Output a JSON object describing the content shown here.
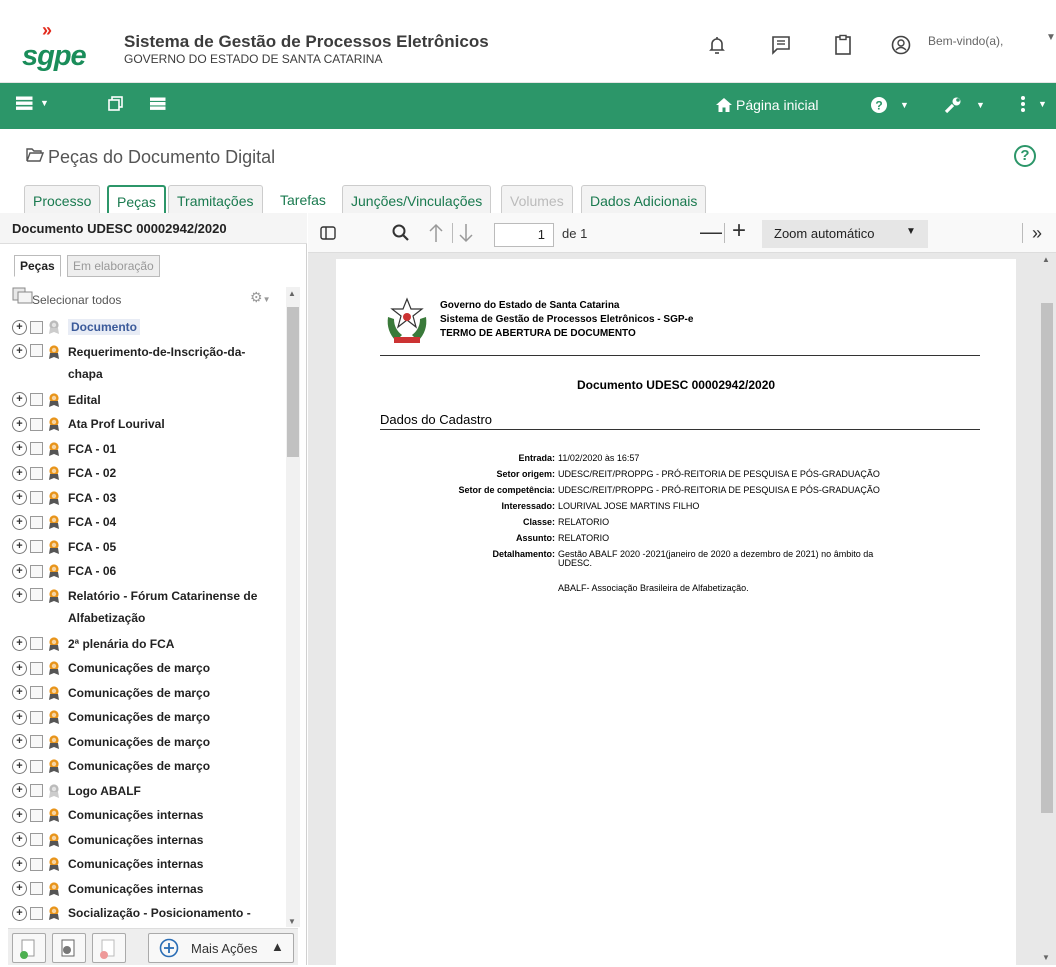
{
  "header": {
    "logo_text": "sgpe",
    "system_title": "Sistema de Gestão de Processos Eletrônicos",
    "system_subtitle": "GOVERNO DO ESTADO DE SANTA CATARINA",
    "welcome": "Bem-vindo(a),",
    "icons": [
      "bell-icon",
      "message-icon",
      "clipboard-icon",
      "user-circle-icon"
    ]
  },
  "navbar": {
    "home_label": "Página inicial",
    "accent": "#2c9669"
  },
  "page": {
    "title": "Peças do Documento Digital"
  },
  "tabs": [
    {
      "label": "Processo",
      "state": "normal"
    },
    {
      "label": "Peças",
      "state": "active"
    },
    {
      "label": "Tramitações",
      "state": "normal"
    },
    {
      "label": "Tarefas",
      "state": "normal"
    },
    {
      "label": "Junções/Vinculações",
      "state": "normal"
    },
    {
      "label": "Volumes",
      "state": "disabled"
    },
    {
      "label": "Dados Adicionais",
      "state": "normal"
    }
  ],
  "left": {
    "doc_header": "Documento UDESC 00002942/2020",
    "subtabs": [
      "Peças",
      "Em elaboração"
    ],
    "select_all": "Selecionar todos",
    "items": [
      "Documento",
      "Requerimento-de-Inscrição-da-chapa",
      "Edital",
      "Ata Prof Lourival",
      "FCA - 01",
      "FCA - 02",
      "FCA - 03",
      "FCA - 04",
      "FCA - 05",
      "FCA - 06",
      "Relatório - Fórum Catarinense de Alfabetização",
      "2ª plenária do FCA",
      "Comunicações de março",
      "Comunicações de março",
      "Comunicações de março",
      "Comunicações de março",
      "Comunicações de março",
      "Logo ABALF",
      "Comunicações internas",
      "Comunicações internas",
      "Comunicações internas",
      "Comunicações internas",
      "Socialização - Posicionamento -"
    ],
    "more_actions": "Mais Ações"
  },
  "viewer": {
    "page_value": "1",
    "page_of": "de 1",
    "zoom": "Zoom automático"
  },
  "document": {
    "gov_line1": "Governo do Estado de Santa Catarina",
    "gov_line2": "Sistema de Gestão de Processos Eletrônicos - SGP-e",
    "gov_line3": "TERMO DE ABERTURA DE DOCUMENTO",
    "doc_number": "Documento UDESC 00002942/2020",
    "section": "Dados do Cadastro",
    "fields": [
      {
        "k": "Entrada:",
        "v": "11/02/2020 às 16:57"
      },
      {
        "k": "Setor origem:",
        "v": "UDESC/REIT/PROPPG - PRÓ-REITORIA DE PESQUISA E PÓS-GRADUAÇÃO"
      },
      {
        "k": "Setor de competência:",
        "v": "UDESC/REIT/PROPPG - PRÓ-REITORIA DE PESQUISA E PÓS-GRADUAÇÃO"
      },
      {
        "k": "Interessado:",
        "v": "LOURIVAL JOSE MARTINS FILHO"
      },
      {
        "k": "Classe:",
        "v": "RELATORIO"
      },
      {
        "k": "Assunto:",
        "v": "RELATORIO"
      },
      {
        "k": "Detalhamento:",
        "v": "Gestão ABALF 2020 -2021(janeiro de 2020 a dezembro de 2021) no âmbito da"
      }
    ],
    "detail_line2": "UDESC.",
    "detail_line3": "ABALF- Associação Brasileira de Alfabetização."
  }
}
